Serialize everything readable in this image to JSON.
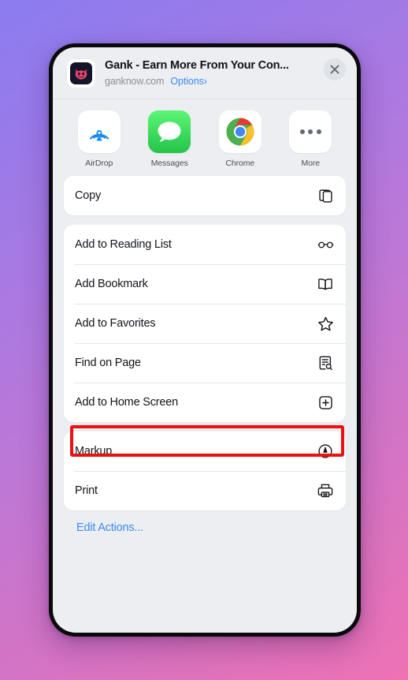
{
  "share_sheet": {
    "header": {
      "app_icon": "gank-app-icon",
      "title": "Gank - Earn More From Your Con...",
      "domain": "ganknow.com",
      "options_label": "Options",
      "options_chevron": "›",
      "close_icon": "close-icon"
    },
    "apps": [
      {
        "label": "AirDrop",
        "icon": "airdrop-icon",
        "tile": "white"
      },
      {
        "label": "Messages",
        "icon": "messages-icon",
        "tile": "msg"
      },
      {
        "label": "Chrome",
        "icon": "chrome-icon",
        "tile": "white"
      },
      {
        "label": "More",
        "icon": "more-icon",
        "tile": "white"
      }
    ],
    "groups": [
      {
        "rows": [
          {
            "label": "Copy",
            "icon": "copy-icon",
            "highlighted": false
          }
        ]
      },
      {
        "rows": [
          {
            "label": "Add to Reading List",
            "icon": "glasses-icon",
            "highlighted": false
          },
          {
            "label": "Add Bookmark",
            "icon": "book-icon",
            "highlighted": false
          },
          {
            "label": "Add to Favorites",
            "icon": "star-icon",
            "highlighted": false
          },
          {
            "label": "Find on Page",
            "icon": "find-page-icon",
            "highlighted": false
          },
          {
            "label": "Add to Home Screen",
            "icon": "plus-square-icon",
            "highlighted": true
          }
        ]
      },
      {
        "rows": [
          {
            "label": "Markup",
            "icon": "markup-icon",
            "highlighted": false
          },
          {
            "label": "Print",
            "icon": "print-icon",
            "highlighted": false
          }
        ]
      }
    ],
    "edit_actions_label": "Edit Actions...",
    "colors": {
      "accent_blue": "#3b8bf5",
      "highlight_red": "#ee1111",
      "sheet_background": "#eceef1",
      "card_background": "#ffffff"
    }
  }
}
